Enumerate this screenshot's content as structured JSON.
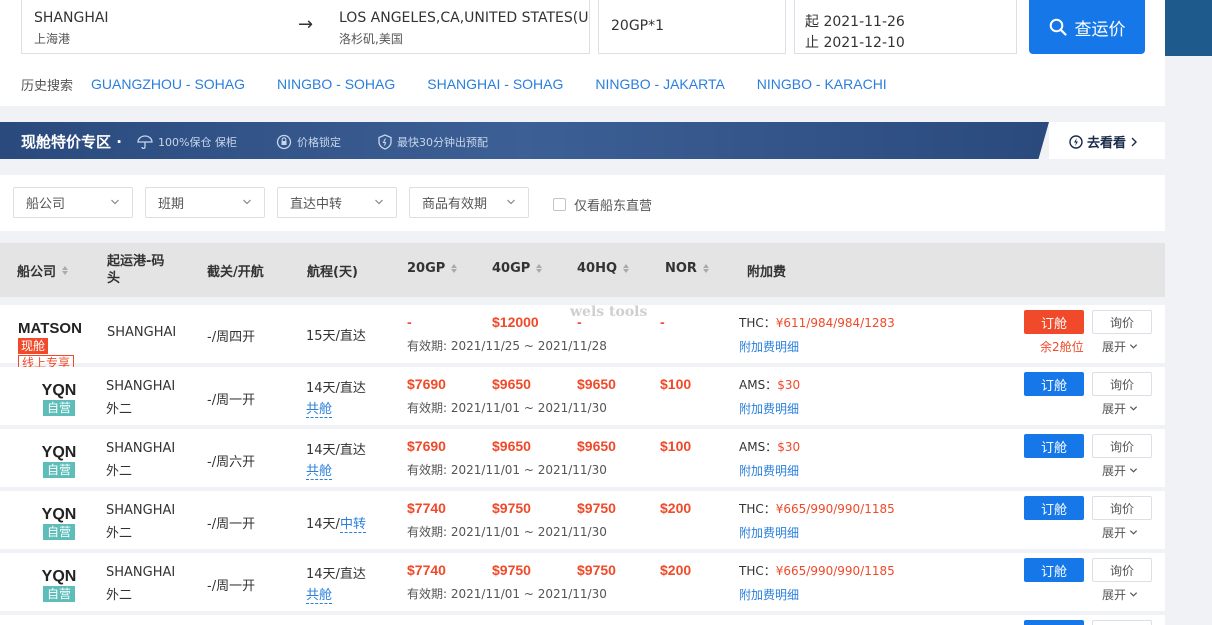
{
  "search": {
    "origin_name": "SHANGHAI",
    "origin_sub": "上海港",
    "arrow": "→",
    "dest_name": "LOS ANGELES,CA,UNITED STATES(U...",
    "dest_sub": "洛杉矶,美国",
    "box": "20GP*1",
    "date_start": "起 2021-11-26",
    "date_end": "止 2021-12-10",
    "button_label": "查运价"
  },
  "history": {
    "label": "历史搜索",
    "links": [
      "GUANGZHOU - SOHAG",
      "NINGBO - SOHAG",
      "SHANGHAI - SOHAG",
      "NINGBO - JAKARTA",
      "NINGBO - KARACHI"
    ]
  },
  "banner": {
    "title": "现舱特价专区 ·",
    "features": [
      "100%保仓 保柜",
      "价格锁定",
      "最快30分钟出预配"
    ],
    "goto": "去看看"
  },
  "filters": {
    "selects": [
      "船公司",
      "班期",
      "直达中转",
      "商品有效期"
    ],
    "checkbox_label": "仅看船东直营"
  },
  "table": {
    "headers": [
      "船公司",
      "起运港-码头",
      "截关/开航",
      "航程(天)",
      "20GP",
      "40GP",
      "40HQ",
      "NOR",
      "附加费"
    ],
    "book_label": "订舱",
    "inquiry_label": "询价",
    "expand_label": "展开",
    "surcharge_link": "附加费明细",
    "rows": [
      {
        "carrier": "MATSON",
        "tags": [
          "现舱",
          "线上专享"
        ],
        "port": "SHANGHAI",
        "port_sub": "",
        "schedule": "-/周四开",
        "transit": "15天/直达",
        "transit_link": "",
        "p20": "-",
        "p40": "$12000",
        "p40hq": "-",
        "nor": "-",
        "valid": "有效期: 2021/11/25 ~ 2021/11/28",
        "surcharge_label": "THC：",
        "surcharge_value": "¥611/984/984/1283",
        "remain": "余2舱位"
      },
      {
        "carrier": "YQN",
        "tags": [
          "自营"
        ],
        "port": "SHANGHAI",
        "port_sub": "外二",
        "schedule": "-/周一开",
        "transit": "14天/直达",
        "transit_link": "共舱",
        "p20": "$7690",
        "p40": "$9650",
        "p40hq": "$9650",
        "nor": "$100",
        "valid": "有效期: 2021/11/01 ~ 2021/11/30",
        "surcharge_label": "AMS：",
        "surcharge_value": "$30",
        "remain": ""
      },
      {
        "carrier": "YQN",
        "tags": [
          "自营"
        ],
        "port": "SHANGHAI",
        "port_sub": "外二",
        "schedule": "-/周六开",
        "transit": "14天/直达",
        "transit_link": "共舱",
        "p20": "$7690",
        "p40": "$9650",
        "p40hq": "$9650",
        "nor": "$100",
        "valid": "有效期: 2021/11/01 ~ 2021/11/30",
        "surcharge_label": "AMS：",
        "surcharge_value": "$30",
        "remain": ""
      },
      {
        "carrier": "YQN",
        "tags": [
          "自营"
        ],
        "port": "SHANGHAI",
        "port_sub": "外二",
        "schedule": "-/周一开",
        "transit": "14天/",
        "transit_link": "中转",
        "p20": "$7740",
        "p40": "$9750",
        "p40hq": "$9750",
        "nor": "$200",
        "valid": "有效期: 2021/11/01 ~ 2021/11/30",
        "surcharge_label": "THC：",
        "surcharge_value": "¥665/990/990/1185",
        "remain": ""
      },
      {
        "carrier": "YQN",
        "tags": [
          "自营"
        ],
        "port": "SHANGHAI",
        "port_sub": "外二",
        "schedule": "-/周一开",
        "transit": "14天/直达",
        "transit_link": "共舱",
        "p20": "$7740",
        "p40": "$9750",
        "p40hq": "$9750",
        "nor": "$200",
        "valid": "有效期: 2021/11/01 ~ 2021/11/30",
        "surcharge_label": "THC：",
        "surcharge_value": "¥665/990/990/1185",
        "remain": ""
      }
    ]
  },
  "watermark": "wels tools",
  "colors": {
    "primary": "#1677e8",
    "price": "#f04a2a",
    "self_tag": "#5cbdb9",
    "banner": "#2a4a7d"
  }
}
